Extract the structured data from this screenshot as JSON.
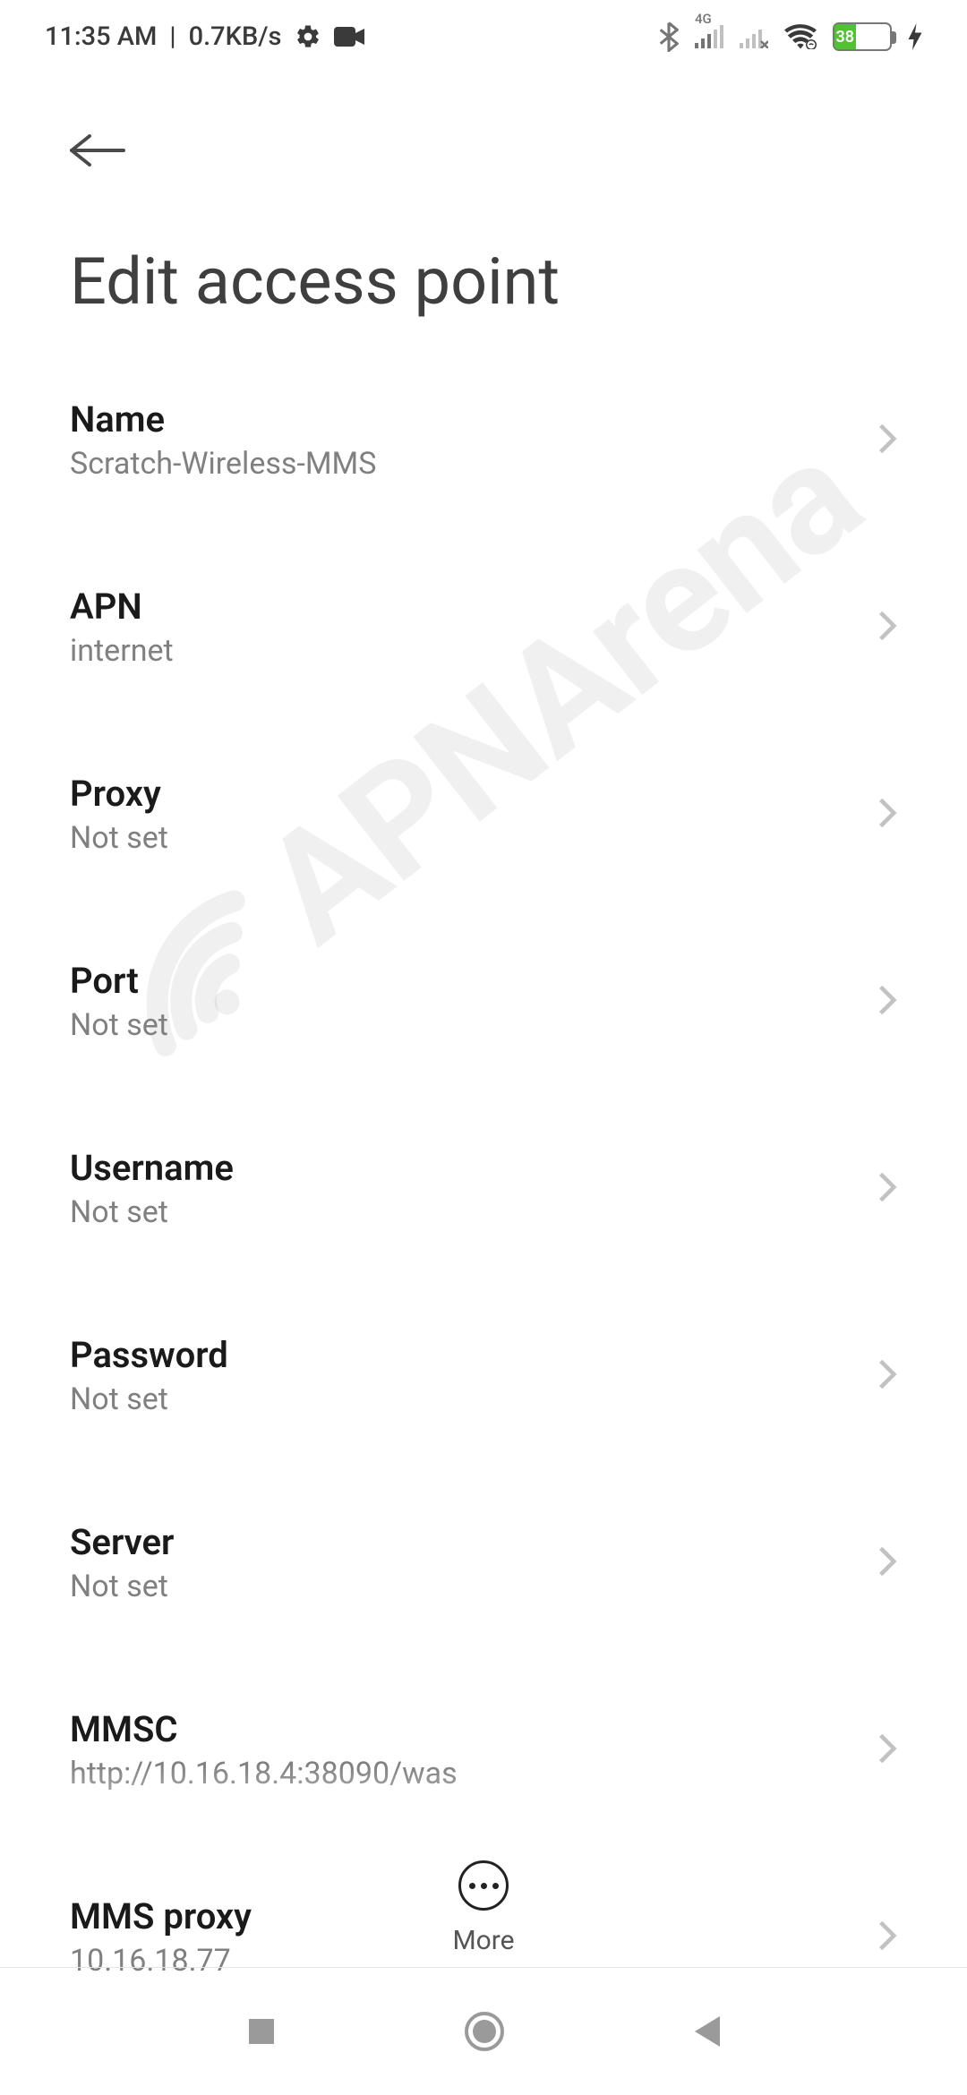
{
  "status": {
    "time": "11:35 AM",
    "net_speed": "0.7KB/s",
    "network_label": "4G",
    "battery_pct": "38"
  },
  "header": {
    "title": "Edit access point"
  },
  "settings": [
    {
      "title": "Name",
      "value": "Scratch-Wireless-MMS"
    },
    {
      "title": "APN",
      "value": "internet"
    },
    {
      "title": "Proxy",
      "value": "Not set"
    },
    {
      "title": "Port",
      "value": "Not set"
    },
    {
      "title": "Username",
      "value": "Not set"
    },
    {
      "title": "Password",
      "value": "Not set"
    },
    {
      "title": "Server",
      "value": "Not set"
    },
    {
      "title": "MMSC",
      "value": "http://10.16.18.4:38090/was"
    },
    {
      "title": "MMS proxy",
      "value": "10.16.18.77"
    }
  ],
  "bottom": {
    "more_label": "More"
  },
  "watermark": {
    "text": "APNArena"
  }
}
